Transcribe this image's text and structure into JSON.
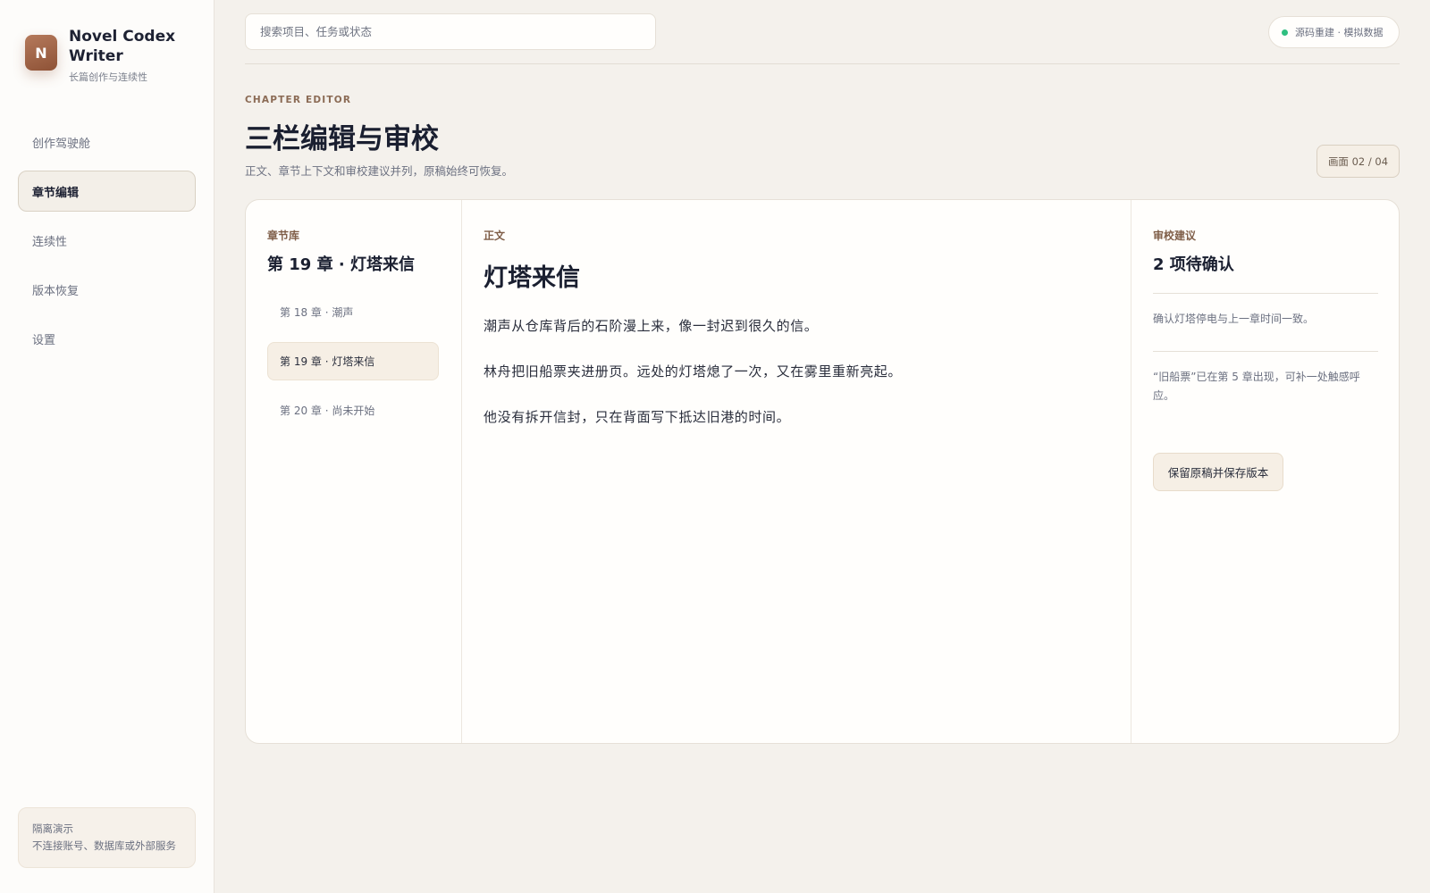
{
  "app": {
    "logo_letter": "N",
    "name": "Novel Codex Writer",
    "subtitle": "长篇创作与连续性"
  },
  "sidebar": {
    "items": [
      {
        "label": "创作驾驶舱",
        "active": false
      },
      {
        "label": "章节编辑",
        "active": true
      },
      {
        "label": "连续性",
        "active": false
      },
      {
        "label": "版本恢复",
        "active": false
      },
      {
        "label": "设置",
        "active": false
      }
    ],
    "demo": {
      "title": "隔离演示",
      "text": "不连接账号、数据库或外部服务"
    }
  },
  "topbar": {
    "search_placeholder": "搜索项目、任务或状态",
    "status_text": "源码重建 · 模拟数据",
    "status_color": "#2fbf80"
  },
  "header": {
    "eyebrow": "CHAPTER EDITOR",
    "title": "三栏编辑与审校",
    "subtitle": "正文、章节上下文和审校建议并列，原稿始终可恢复。",
    "screen_badge": "画面 02 / 04"
  },
  "library": {
    "label": "章节库",
    "current": "第 19 章 · 灯塔来信",
    "chapters": [
      {
        "label": "第 18 章 · 潮声",
        "active": false
      },
      {
        "label": "第 19 章 · 灯塔来信",
        "active": true
      },
      {
        "label": "第 20 章 · 尚未开始",
        "active": false
      }
    ]
  },
  "body_text": {
    "label": "正文",
    "title": "灯塔来信",
    "paragraphs": [
      "潮声从仓库背后的石阶漫上来，像一封迟到很久的信。",
      "林舟把旧船票夹进册页。远处的灯塔熄了一次，又在雾里重新亮起。",
      "他没有拆开信封，只在背面写下抵达旧港的时间。"
    ]
  },
  "review": {
    "label": "审校建议",
    "heading": "2 项待确认",
    "items": [
      "确认灯塔停电与上一章时间一致。",
      "“旧船票”已在第 5 章出现，可补一处触感呼应。"
    ],
    "button_label": "保留原稿并保存版本"
  },
  "colors": {
    "accent": "#8e5236",
    "background": "#f4f1ec",
    "surface": "#fffefc"
  }
}
